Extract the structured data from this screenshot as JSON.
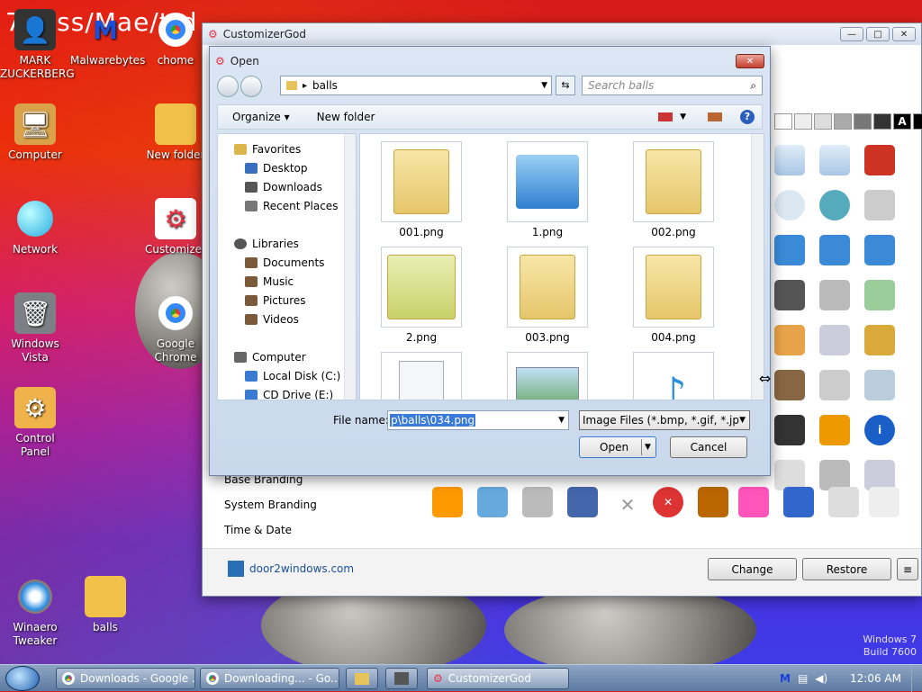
{
  "desktop": {
    "top_text": "7Boss/Mae/ttd",
    "icons": [
      {
        "label": "MARK ZUCKERBERG"
      },
      {
        "label": "Malwarebytes"
      },
      {
        "label": "chome"
      },
      {
        "label": "Computer"
      },
      {
        "label": "New folder"
      },
      {
        "label": "Network"
      },
      {
        "label": "Customizer"
      },
      {
        "label": "Windows Vista"
      },
      {
        "label": "Google Chrome"
      },
      {
        "label": "Control Panel"
      },
      {
        "label": "Winaero Tweaker"
      },
      {
        "label": "balls"
      }
    ],
    "watermark": [
      "Windows 7",
      "Build 7600"
    ]
  },
  "customizer": {
    "title": "CustomizerGod",
    "menu": [
      "Base Branding",
      "System Branding",
      "Time & Date"
    ],
    "link": "door2windows.com",
    "change_label": "Change",
    "restore_label": "Restore",
    "menu_btn": "≡",
    "swatch_letter": "A"
  },
  "dialog": {
    "title": "Open",
    "path": "balls",
    "search_placeholder": "Search balls",
    "organize_label": "Organize",
    "new_folder_label": "New folder",
    "nav": [
      {
        "label": "Favorites",
        "group": true
      },
      {
        "label": "Desktop"
      },
      {
        "label": "Downloads"
      },
      {
        "label": "Recent Places"
      },
      {
        "label": "Libraries",
        "group": true
      },
      {
        "label": "Documents"
      },
      {
        "label": "Music"
      },
      {
        "label": "Pictures"
      },
      {
        "label": "Videos"
      },
      {
        "label": "Computer",
        "group": true
      },
      {
        "label": "Local Disk (C:)"
      },
      {
        "label": "CD Drive (E:)"
      }
    ],
    "files": [
      {
        "name": "001.png"
      },
      {
        "name": "1.png"
      },
      {
        "name": "002.png"
      },
      {
        "name": "2.png"
      },
      {
        "name": "003.png"
      },
      {
        "name": "004.png"
      },
      {
        "name": ""
      },
      {
        "name": ""
      },
      {
        "name": ""
      }
    ],
    "filename_label": "File name:",
    "filename_value": "p\\balls\\034.png",
    "filetype_value": "Image Files (*.bmp, *.gif, *.jpg,",
    "open_label": "Open",
    "cancel_label": "Cancel"
  },
  "taskbar": {
    "tasks": [
      "Downloads - Google ...",
      "Downloading... - Go...",
      "CustomizerGod"
    ],
    "clock": "12:06 AM"
  }
}
